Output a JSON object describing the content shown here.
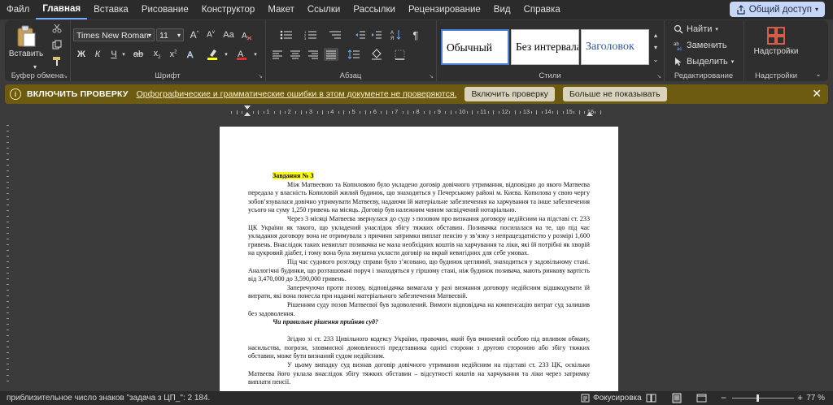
{
  "menu": {
    "items": [
      "Файл",
      "Главная",
      "Вставка",
      "Рисование",
      "Конструктор",
      "Макет",
      "Ссылки",
      "Рассылки",
      "Рецензирование",
      "Вид",
      "Справка"
    ],
    "active_index": 1,
    "share_label": "Общий доступ"
  },
  "ribbon": {
    "clipboard": {
      "paste_label": "Вставить",
      "group_label": "Буфер обмена"
    },
    "font": {
      "name": "Times New Roman",
      "size": "11",
      "group_label": "Шрифт",
      "font_color": "#e03030",
      "highlight_color": "#ffff00"
    },
    "paragraph": {
      "group_label": "Абзац"
    },
    "styles": {
      "items": [
        "Обычный",
        "Без интервала",
        "Заголовок"
      ],
      "group_label": "Стили"
    },
    "editing": {
      "find_label": "Найти",
      "replace_label": "Заменить",
      "select_label": "Выделить",
      "group_label": "Редактирование"
    },
    "addins": {
      "label": "Надстройки",
      "group_label": "Надстройки"
    }
  },
  "infobar": {
    "title": "ВКЛЮЧИТЬ ПРОВЕРКУ",
    "message": "Орфографические и грамматические ошибки в этом документе не проверяются.",
    "enable_button": "Включить проверку",
    "dismiss_button": "Больше не показывать"
  },
  "ruler": {
    "labels": [
      "1",
      "2",
      "3",
      "4",
      "5",
      "6",
      "7",
      "8",
      "9",
      "10",
      "11",
      "12",
      "13",
      "14",
      "15",
      "16"
    ]
  },
  "document": {
    "heading": "Завдання № 3",
    "p1": "Між Матвеєвою та Копиловою було укладено договір довічного утримання, відповідно до якого Матвеєва передала у власність Копиловій жилий будинок, що знаходиться у Печерському районі м. Києва. Копилова у свою чергу зобов’язувалася довічно утримувати Матвеєву, надаючи їй матеріальне забезпечення на харчування та інше забезпечення усього на суму 1,250 гривень на місяць. Договір був належним чином засвідчений нотаріально.",
    "p2": "Через 3 місяці Матвеєва звернулася до суду з позовом про визнання договору недійсним на підставі ст. 233 ЦК України як такого, що укладений унаслідок збігу тяжких обставин. Позивачка посилалася на те, що під час укладання договору вона не отримувала з причини затримки виплат пенсію у зв’язку з непрацездатністю у розмірі 1,600 гривень. Внаслідок таких невиплат позивачка не мала необхідних коштів на харчування та ліки, які їй потрібні як хворій на цукровий діабет, і тому вона була змушена укласти договір на вкрай невигідних для себе умовах.",
    "p3": "Під час судового розгляду справи було з’ясовано, що будинок цегляний, знаходиться у задовільному стані. Аналогічні будинки, що розташовані поруч і знаходяться у гіршому стані, ніж будинок позивача, мають ринкову вартість від 3,470,000 до 3,590,000 гривень.",
    "p4": "Заперечуючи проти позову, відповідачка вимагала у разі визнання договору недійсним відшкодувати їй витрати, які вона понесла при наданні матеріального забезпечення Матвеєвій.",
    "p5": "Рішенням суду позов Матвеєвої був задоволений. Вимоги відповідача на компенсацію витрат суд залишив без задоволення.",
    "question": "Чи правильне рішення прийняв суд?",
    "p6": "Згідно зі ст. 233 Цивільного кодексу України, правочин, який був вчинений особою під впливом обману, насильства, погрози, зловмисної домовленості представника однієї сторони з другою стороною або збігу тяжких обставин, може бути визнаний судом недійсним.",
    "p7": "У цьому випадку суд визнав договір довічного утримання недійсним на підставі ст. 233 ЦК, оскільки Матвеєва його уклала внаслідок збігу тяжких обставин – відсутності коштів на харчування та ліки через затримку виплати пенсії."
  },
  "status": {
    "word_count": "приблизительное число знаков \"задача з ЦП_\": 2 184.",
    "focus_label": "Фокусировка",
    "zoom": "77 %"
  }
}
